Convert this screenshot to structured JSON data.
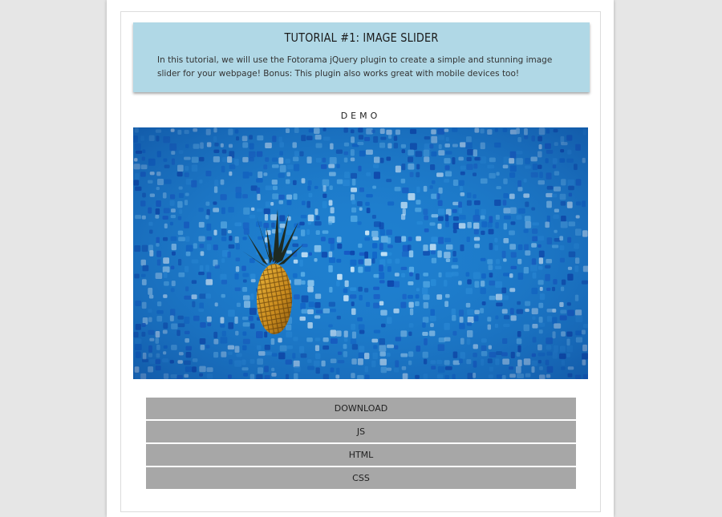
{
  "intro": {
    "title": "TUTORIAL #1: IMAGE SLIDER",
    "text": "In this tutorial, we will use the Fotorama jQuery plugin to create a simple and stunning image slider for your webpage! Bonus: This plugin also works great with mobile devices too!"
  },
  "demo": {
    "label": "DEMO",
    "image": "pineapple floating in a blue tiled swimming pool"
  },
  "buttons": [
    "DOWNLOAD",
    "JS",
    "HTML",
    "CSS"
  ],
  "colors": {
    "page_bg": "#e6e6e6",
    "intro_bg": "#b0d8e6",
    "button_bg": "#a7a7a7",
    "pool_blue": "#1c78c6"
  }
}
